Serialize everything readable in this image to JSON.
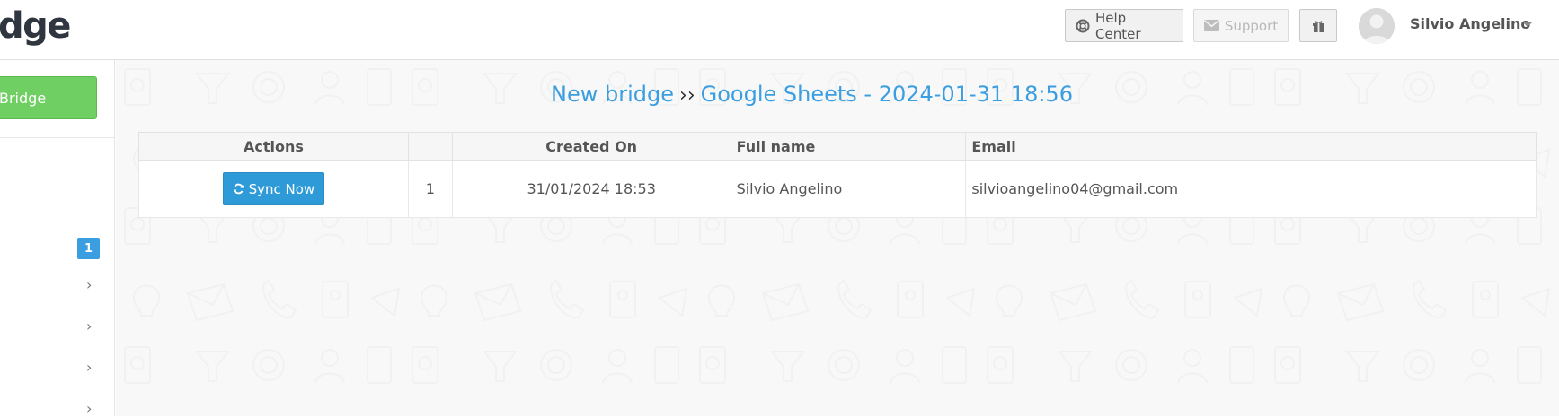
{
  "header": {
    "brand": "dge",
    "help_center": "Help Center",
    "support": "Support",
    "user_name": "Silvio Angelino"
  },
  "sidebar": {
    "new_bridge": "Bridge",
    "badge_count": "1",
    "chevron": "›"
  },
  "main": {
    "title_part1": "New bridge",
    "title_sep": "››",
    "title_part2": "Google Sheets - 2024-01-31 18:56",
    "columns": [
      "Actions",
      "",
      "Created On",
      "Full name",
      "Email"
    ],
    "rows": [
      {
        "action": "Sync Now",
        "index": "1",
        "created_on": "31/01/2024 18:53",
        "full_name": "Silvio Angelino",
        "email": "silvioangelino04@gmail.com"
      }
    ]
  },
  "colors": {
    "accent": "#3a9ee0",
    "new_bridge_green": "#6fcf62",
    "sync_blue": "#2e9bd8"
  },
  "icons": {
    "help": "lifebuoy-icon",
    "support": "envelope-icon",
    "gift": "gift-icon",
    "sync": "refresh-icon",
    "user": "user-avatar-icon"
  }
}
